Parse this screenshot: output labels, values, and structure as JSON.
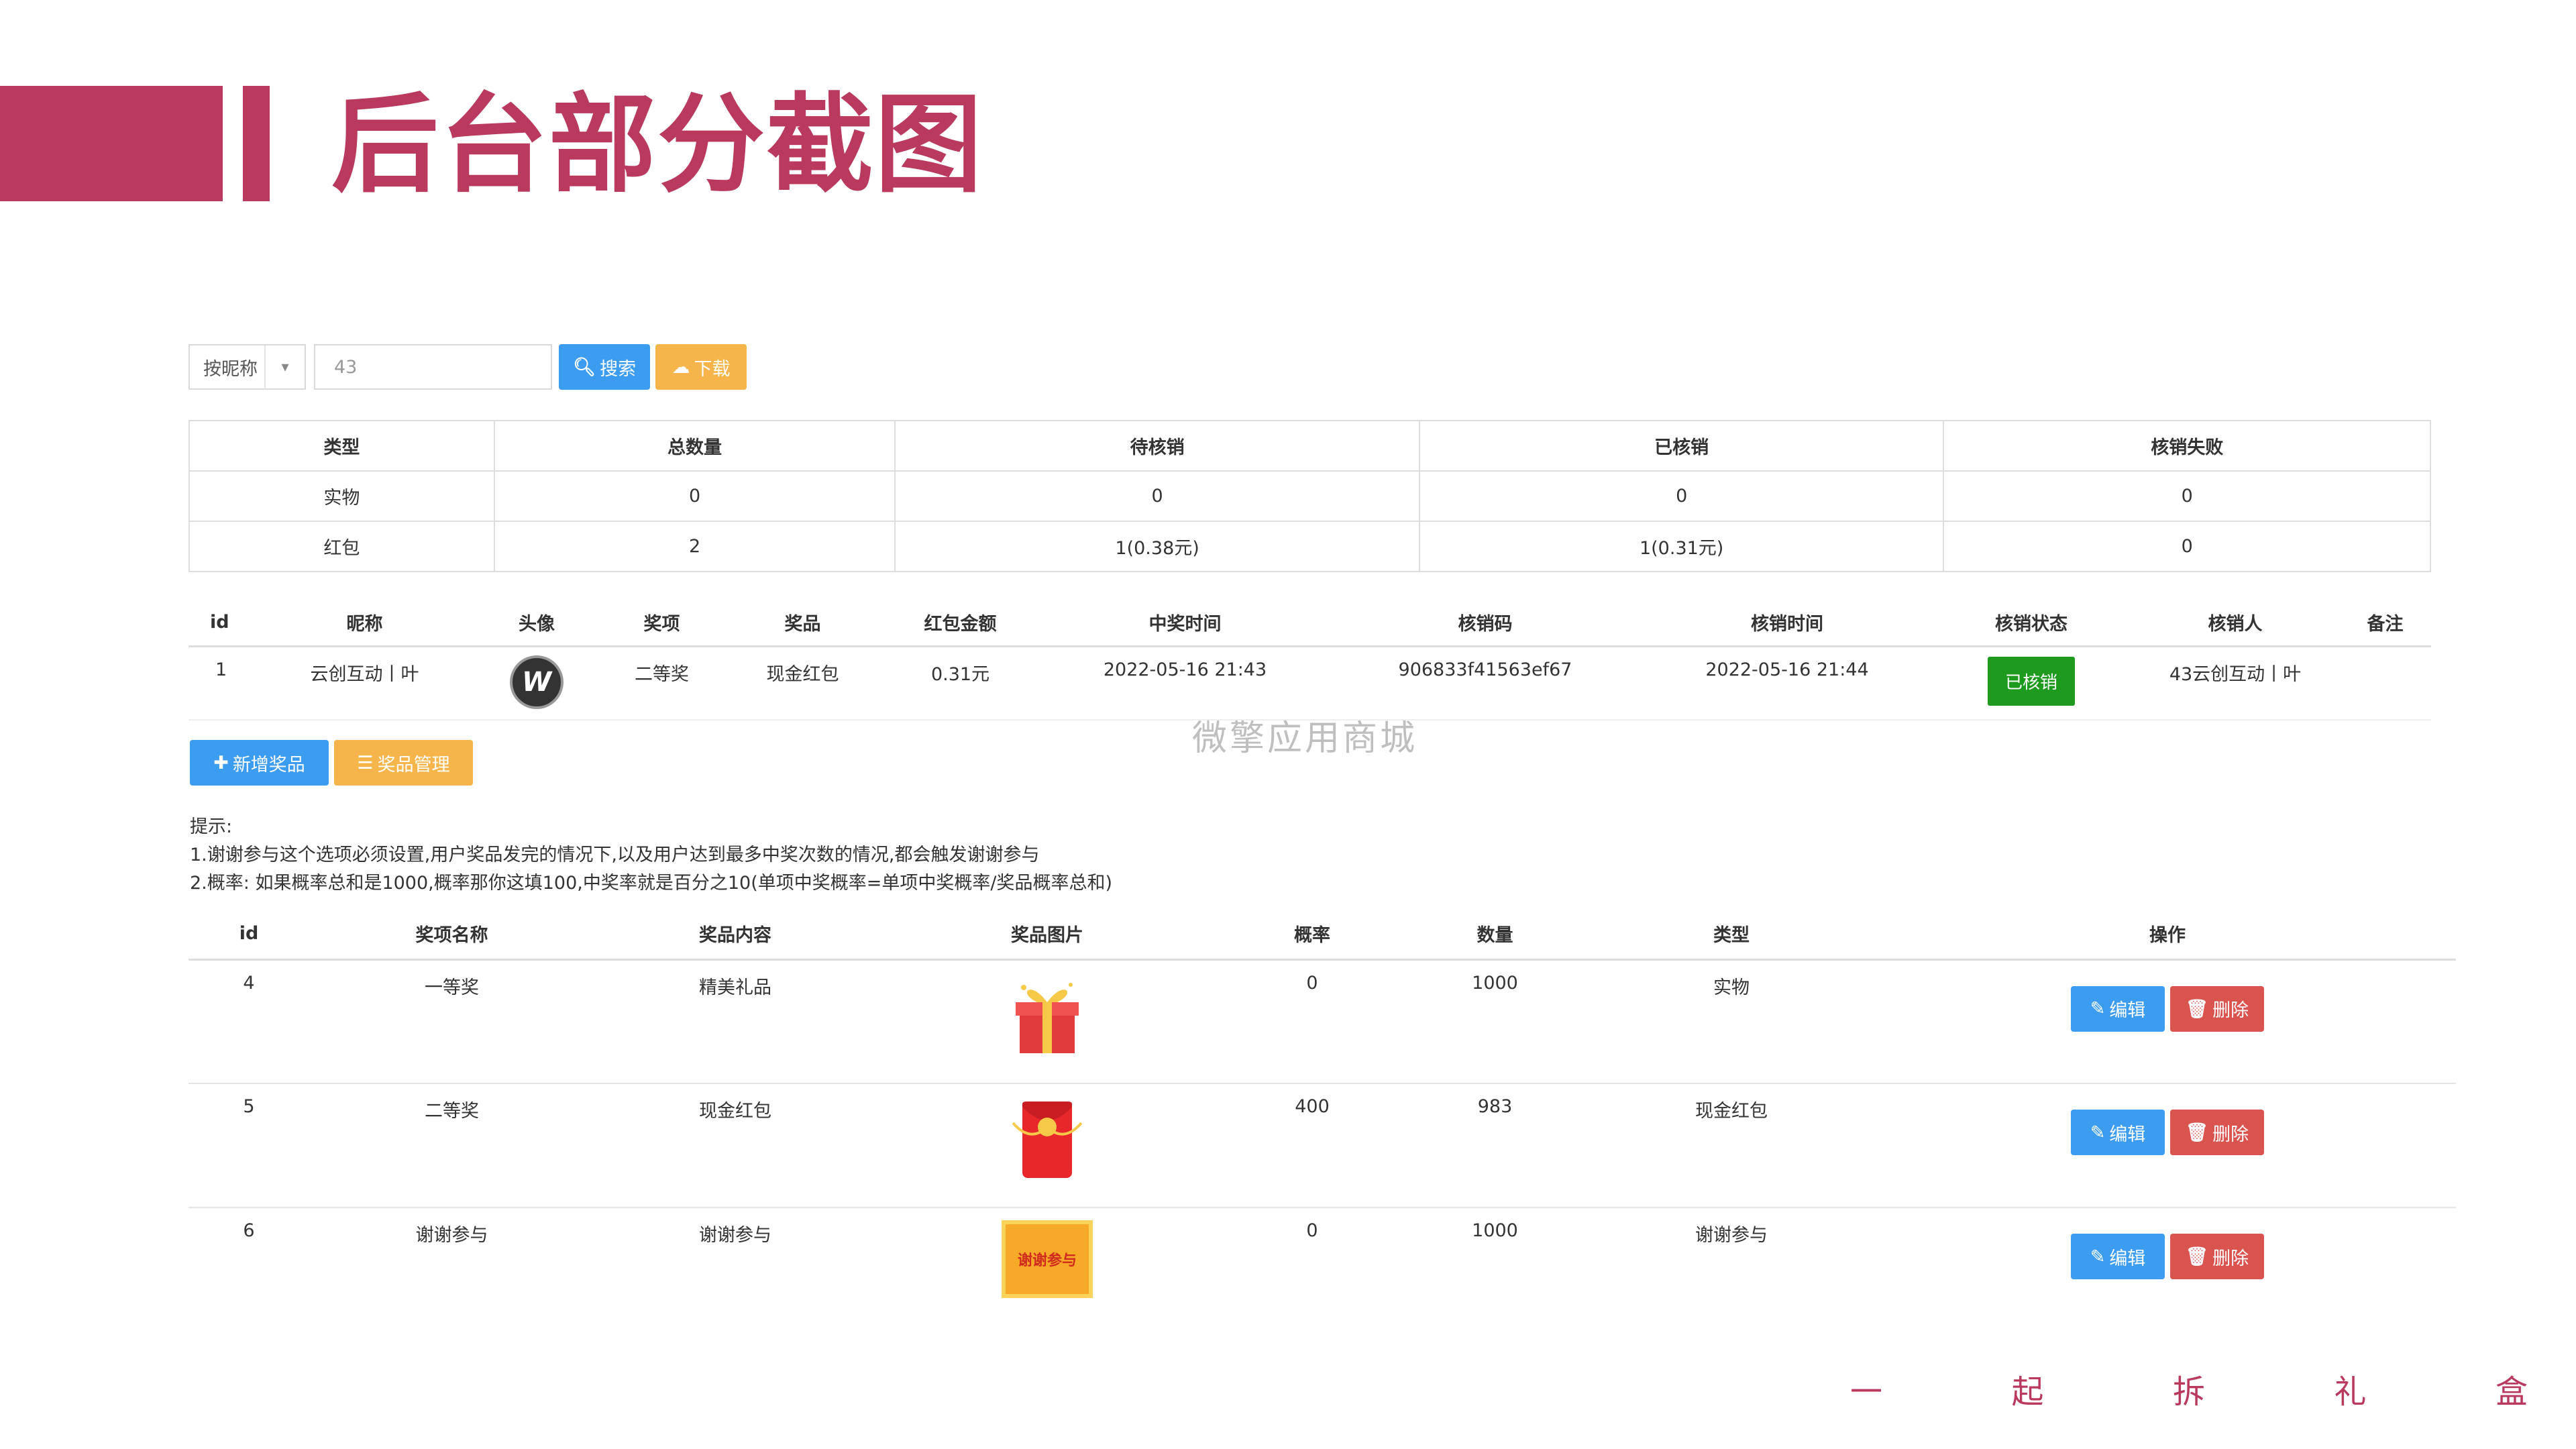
{
  "slide": {
    "title": "后台部分截图",
    "accent_color": "#b9395f",
    "watermark": "微擎应用商城",
    "footer_chars": [
      "一",
      "起",
      "拆",
      "礼",
      "盒"
    ]
  },
  "search": {
    "filter_select": "按昵称",
    "query_value": "43",
    "search_label": "搜索",
    "download_label": "下载"
  },
  "stats": {
    "headers": [
      "类型",
      "总数量",
      "待核销",
      "已核销",
      "核销失败"
    ],
    "rows": [
      [
        "实物",
        "0",
        "0",
        "0",
        "0"
      ],
      [
        "红包",
        "2",
        "1(0.38元)",
        "1(0.31元)",
        "0"
      ]
    ]
  },
  "records": {
    "headers": [
      "id",
      "昵称",
      "头像",
      "奖项",
      "奖品",
      "红包金额",
      "中奖时间",
      "核销码",
      "核销时间",
      "核销状态",
      "核销人",
      "备注"
    ],
    "rows": [
      {
        "id": "1",
        "nickname": "云创互动丨叶",
        "award": "二等奖",
        "prize": "现金红包",
        "amount": "0.31元",
        "win_time": "2022-05-16 21:43",
        "code": "906833f41563ef67",
        "verify_time": "2022-05-16 21:44",
        "status": "已核销",
        "verifier": "43云创互动丨叶",
        "remark": ""
      }
    ]
  },
  "actions": {
    "add_prize": "新增奖品",
    "manage_prize": "奖品管理"
  },
  "tips": {
    "title": "提示:",
    "line1": "1.谢谢参与这个选项必须设置,用户奖品发完的情况下,以及用户达到最多中奖次数的情况,都会触发谢谢参与",
    "line2": "2.概率: 如果概率总和是1000,概率那你这填100,中奖率就是百分之10(单项中奖概率=单项中奖概率/奖品概率总和)"
  },
  "prizes": {
    "headers": [
      "id",
      "奖项名称",
      "奖品内容",
      "奖品图片",
      "概率",
      "数量",
      "类型",
      "操作"
    ],
    "edit_label": "编辑",
    "delete_label": "删除",
    "rows": [
      {
        "id": "4",
        "name": "一等奖",
        "content": "精美礼品",
        "image": "gift-box",
        "prob": "0",
        "qty": "1000",
        "type": "实物"
      },
      {
        "id": "5",
        "name": "二等奖",
        "content": "现金红包",
        "image": "red-envelope",
        "prob": "400",
        "qty": "983",
        "type": "现金红包"
      },
      {
        "id": "6",
        "name": "谢谢参与",
        "content": "谢谢参与",
        "image": "thanks-card",
        "image_text": "谢谢参与",
        "prob": "0",
        "qty": "1000",
        "type": "谢谢参与"
      }
    ]
  }
}
